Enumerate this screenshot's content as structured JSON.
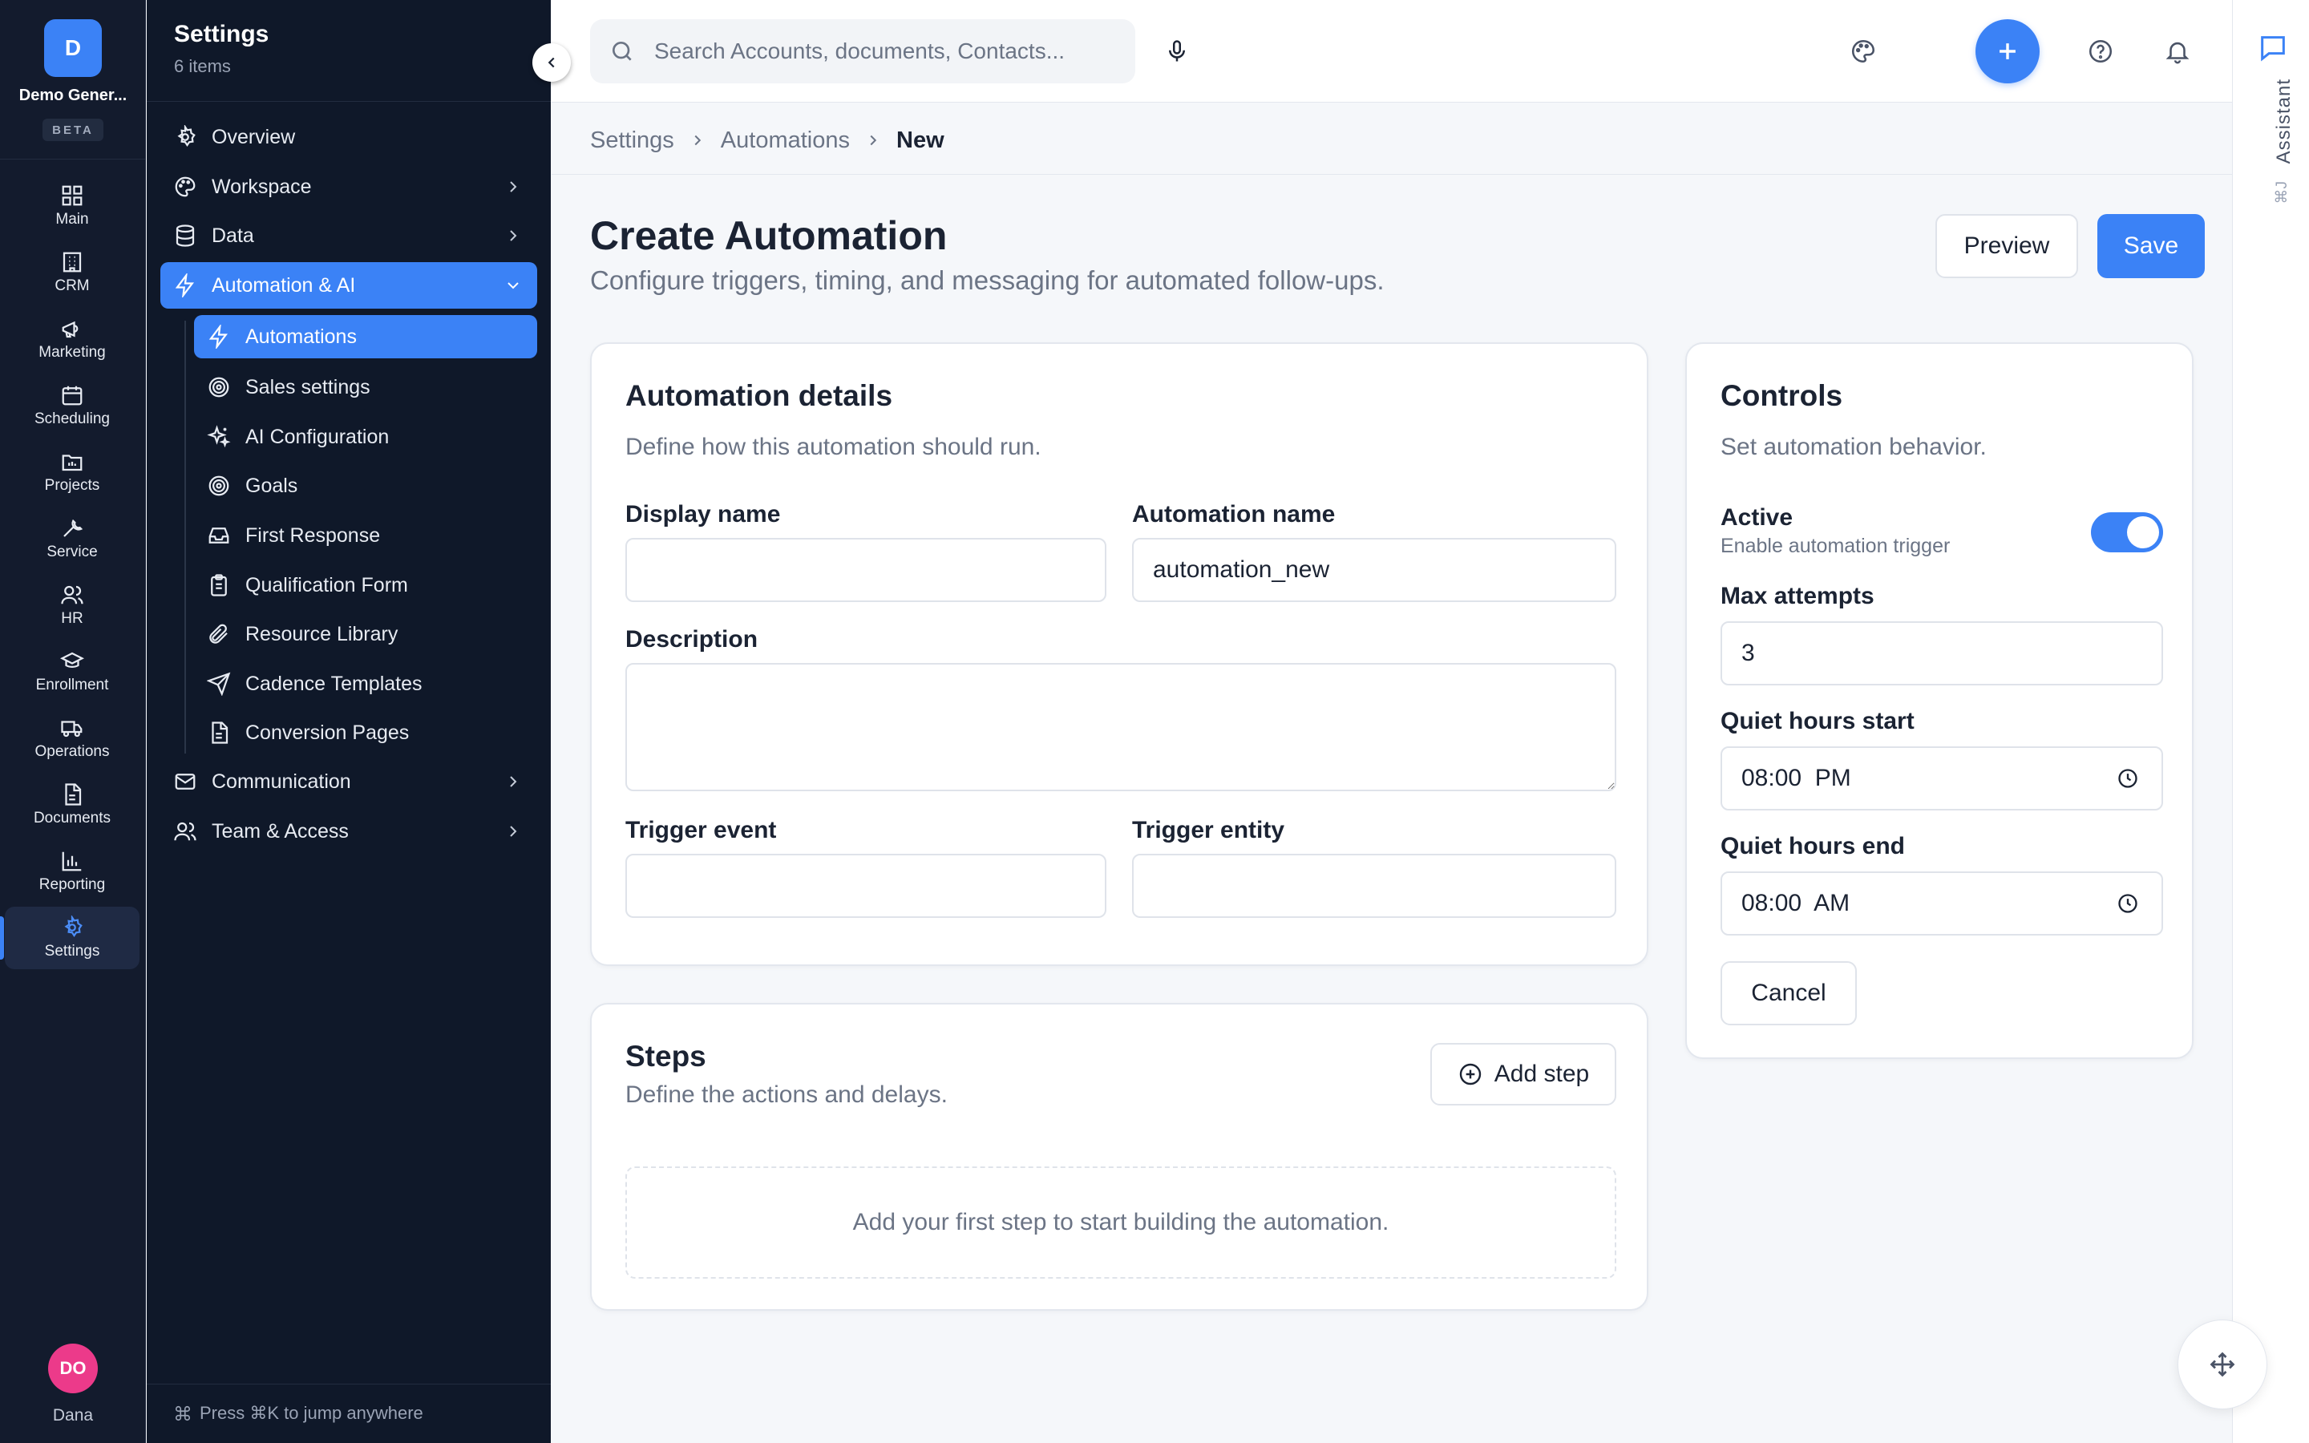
{
  "rail": {
    "org_initial": "D",
    "org_name": "Demo Gener...",
    "beta_label": "BETA",
    "items": [
      {
        "label": "Main",
        "icon": "grid-icon"
      },
      {
        "label": "CRM",
        "icon": "building-icon"
      },
      {
        "label": "Marketing",
        "icon": "megaphone-icon"
      },
      {
        "label": "Scheduling",
        "icon": "calendar-icon"
      },
      {
        "label": "Projects",
        "icon": "folder-icon"
      },
      {
        "label": "Service",
        "icon": "wrench-icon"
      },
      {
        "label": "HR",
        "icon": "users-icon"
      },
      {
        "label": "Enrollment",
        "icon": "graduation-cap-icon"
      },
      {
        "label": "Operations",
        "icon": "truck-icon"
      },
      {
        "label": "Documents",
        "icon": "file-text-icon"
      },
      {
        "label": "Reporting",
        "icon": "bar-chart-icon"
      },
      {
        "label": "Settings",
        "icon": "gear-icon",
        "active": true
      }
    ],
    "user_initials": "DO",
    "user_name": "Dana"
  },
  "sidebar": {
    "title": "Settings",
    "count": "6 items",
    "nav": [
      {
        "label": "Overview",
        "icon": "gear-icon"
      },
      {
        "label": "Workspace",
        "icon": "palette-icon",
        "chevron": "right"
      },
      {
        "label": "Data",
        "icon": "database-icon",
        "chevron": "right"
      },
      {
        "label": "Automation & AI",
        "icon": "zap-icon",
        "chevron": "down",
        "active": true
      },
      {
        "label": "Communication",
        "icon": "mail-icon",
        "chevron": "right"
      },
      {
        "label": "Team & Access",
        "icon": "users-icon",
        "chevron": "right"
      }
    ],
    "subnav": [
      {
        "label": "Automations",
        "icon": "zap-icon",
        "active": true
      },
      {
        "label": "Sales settings",
        "icon": "target-icon"
      },
      {
        "label": "AI Configuration",
        "icon": "sparkles-icon"
      },
      {
        "label": "Goals",
        "icon": "target-icon"
      },
      {
        "label": "First Response",
        "icon": "inbox-icon"
      },
      {
        "label": "Qualification Form",
        "icon": "clipboard-icon"
      },
      {
        "label": "Resource Library",
        "icon": "paperclip-icon"
      },
      {
        "label": "Cadence Templates",
        "icon": "send-icon"
      },
      {
        "label": "Conversion Pages",
        "icon": "file-text-icon"
      }
    ],
    "footer_hint": "Press ⌘K to jump anywhere",
    "footer_icon": "command-icon"
  },
  "topbar": {
    "search_placeholder": "Search Accounts, documents, Contacts...",
    "icons": [
      "search-icon",
      "microphone-icon",
      "palette-icon",
      "plus-icon",
      "help-icon",
      "bell-icon"
    ]
  },
  "assistant": {
    "label": "Assistant",
    "shortcut": "⌘J"
  },
  "breadcrumb": [
    "Settings",
    "Automations",
    "New"
  ],
  "page": {
    "title": "Create Automation",
    "subtitle": "Configure triggers, timing, and messaging for automated follow-ups.",
    "preview_label": "Preview",
    "save_label": "Save"
  },
  "details": {
    "title": "Automation details",
    "subtitle": "Define how this automation should run.",
    "display_name_label": "Display name",
    "display_name_value": "",
    "automation_name_label": "Automation name",
    "automation_name_value": "automation_new",
    "description_label": "Description",
    "description_value": "",
    "trigger_event_label": "Trigger event",
    "trigger_event_value": "",
    "trigger_entity_label": "Trigger entity",
    "trigger_entity_value": ""
  },
  "controls": {
    "title": "Controls",
    "subtitle": "Set automation behavior.",
    "active_label": "Active",
    "active_hint": "Enable automation trigger",
    "active_on": true,
    "max_attempts_label": "Max attempts",
    "max_attempts_value": "3",
    "quiet_start_label": "Quiet hours start",
    "quiet_start_value": "08:00  PM",
    "quiet_end_label": "Quiet hours end",
    "quiet_end_value": "08:00  AM",
    "cancel_label": "Cancel"
  },
  "steps": {
    "title": "Steps",
    "subtitle": "Define the actions and delays.",
    "add_label": "Add step",
    "empty_text": "Add your first step to start building the automation."
  },
  "colors": {
    "accent": "#3b82f6",
    "sidebar_bg": "#0f1829",
    "rail_bg": "#131b2d",
    "avatar": "#ec3a8a"
  }
}
